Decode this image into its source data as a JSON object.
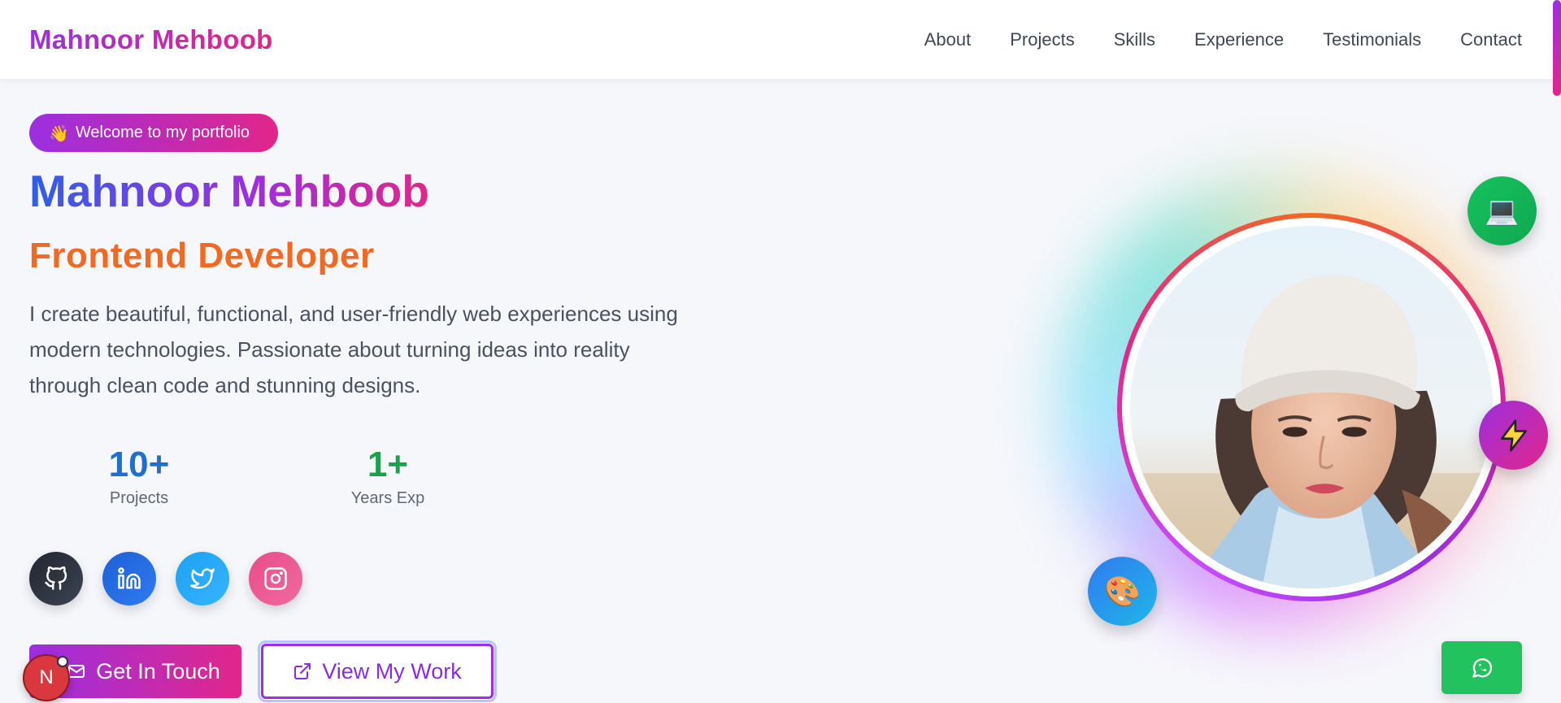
{
  "header": {
    "brand": "Mahnoor Mehboob",
    "nav": [
      "About",
      "Projects",
      "Skills",
      "Experience",
      "Testimonials",
      "Contact"
    ]
  },
  "hero": {
    "badge_emoji": "👋",
    "badge_text": "Welcome to my portfolio",
    "name": "Mahnoor Mehboob",
    "role": "Frontend Developer",
    "description": "I create beautiful, functional, and user-friendly web experiences using modern technologies. Passionate about turning ideas into reality through clean code and stunning designs.",
    "stats": [
      {
        "value": "10+",
        "label": "Projects",
        "color": "#1f6fd1"
      },
      {
        "value": "1+",
        "label": "Years Exp",
        "color": "#16a34a"
      }
    ],
    "socials": [
      "github-icon",
      "linkedin-icon",
      "twitter-icon",
      "instagram-icon"
    ],
    "buttons": {
      "primary": "Get In Touch",
      "secondary": "View My Work"
    }
  },
  "floating": {
    "laptop": "💻",
    "palette": "🎨"
  },
  "avatar_initial": "N",
  "colors": {
    "brand_start": "#9b2fe0",
    "brand_end": "#e2268a",
    "role": "#f26a21",
    "whatsapp": "#22c35e"
  }
}
